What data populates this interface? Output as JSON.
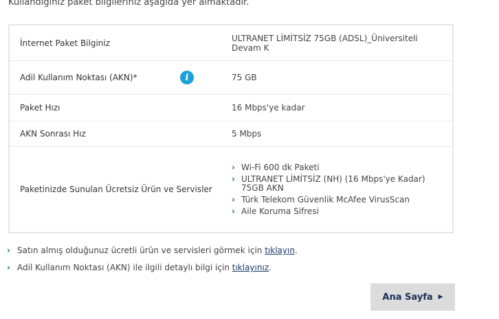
{
  "intro_text": "Kullandığınız paket bilgileriniz aşağıda yer almaktadır.",
  "table": {
    "rows": [
      {
        "label": "İnternet Paket Bilginiz",
        "value": "ULTRANET LİMİTSİZ 75GB (ADSL)_Üniversiteli Devam K"
      },
      {
        "label": "Adil Kullanım Noktası (AKN)*",
        "value": "75 GB",
        "icon": "info-icon"
      },
      {
        "label": "Paket Hızı",
        "value": "16 Mbps'ye kadar"
      },
      {
        "label": "AKN Sonrası Hız",
        "value": "5 Mbps"
      },
      {
        "label": "Paketinizde Sunulan Ücretsiz Ürün ve Servisler",
        "services": [
          "Wi-Fi 600 dk Paketi",
          "ULTRANET LİMİTSİZ (NH) (16 Mbps'ye Kadar) 75GB AKN",
          "Türk Telekom Güvenlik McAfee VirusScan",
          "Aile Koruma Sifresi"
        ]
      }
    ],
    "info_icon_glyph": "i"
  },
  "links": [
    {
      "text": "Satın almış olduğunuz ücretli ürün ve servisleri görmek için ",
      "link": "tıklayın",
      "suffix": "."
    },
    {
      "text": "Adil Kullanım Noktası (AKN) ile ilgili detaylı bilgi için ",
      "link": "tıklayınız",
      "suffix": "."
    }
  ],
  "chevron_glyph": "›",
  "home_button": {
    "label": "Ana Sayfa",
    "icon": "play-arrow-icon",
    "glyph": "▶"
  },
  "colors": {
    "accent": "#1aa1d5",
    "link": "#1a3a6b",
    "button_bg": "#dcdcdc"
  }
}
